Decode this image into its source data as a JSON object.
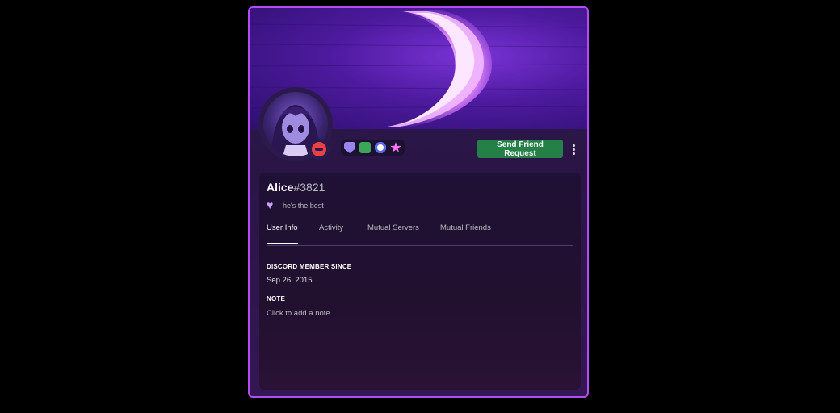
{
  "profile": {
    "username": "Alice",
    "discriminator": "#3821",
    "custom_status_icon": "purple-heart-icon",
    "custom_status_text": "he's the best",
    "status": "do-not-disturb",
    "badges": [
      "hypesquad-badge-icon",
      "nitro-badge-icon",
      "boost-badge-icon",
      "star-badge-icon"
    ]
  },
  "actions": {
    "send_friend_request": "Send Friend Request",
    "more_icon": "more-vertical-icon"
  },
  "tabs": [
    {
      "label": "User Info",
      "active": true
    },
    {
      "label": "Activity",
      "active": false
    },
    {
      "label": "Mutual Servers",
      "active": false
    },
    {
      "label": "Mutual Friends",
      "active": false
    }
  ],
  "info": {
    "member_since_heading": "DISCORD MEMBER SINCE",
    "member_since_value": "Sep 26, 2015",
    "note_heading": "NOTE",
    "note_placeholder": "Click to add a note"
  },
  "colors": {
    "accent_border": "#b04ef0",
    "friend_button": "#248046",
    "dnd_status": "#ed4245"
  }
}
